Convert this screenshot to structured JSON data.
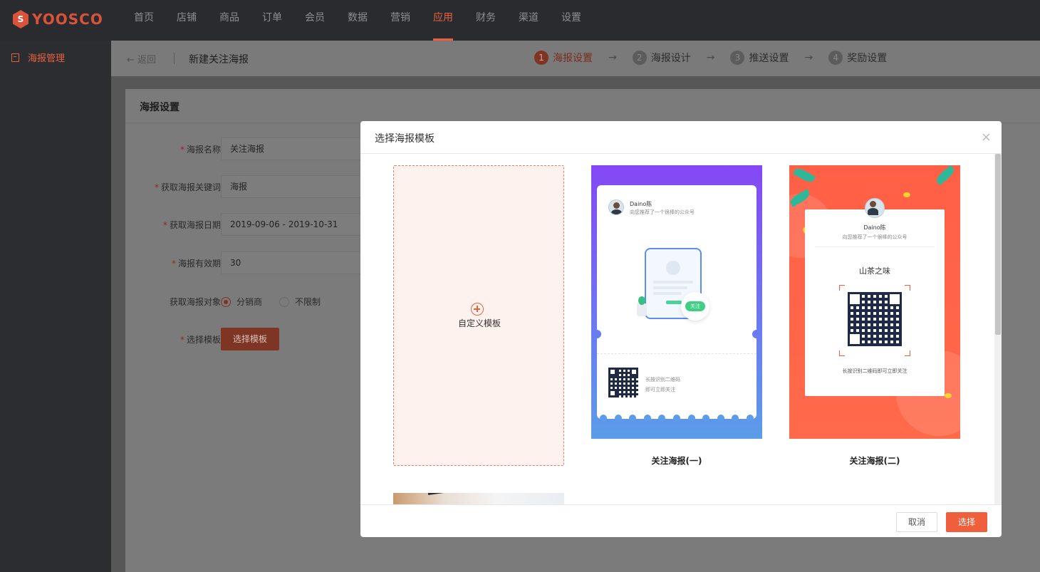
{
  "brand": {
    "logo_letter": "S",
    "name": "YOOSCO",
    "color": "#d9533b"
  },
  "nav": {
    "items": [
      "首页",
      "店铺",
      "商品",
      "订单",
      "会员",
      "数据",
      "营销",
      "应用",
      "财务",
      "渠道",
      "设置"
    ],
    "active": "应用"
  },
  "sidebar": {
    "items": [
      {
        "label": "海报管理",
        "icon": "poster-icon"
      }
    ]
  },
  "header": {
    "back_label": "返回",
    "title": "新建关注海报",
    "steps": [
      {
        "num": "1",
        "label": "海报设置",
        "active": true
      },
      {
        "num": "2",
        "label": "海报设计",
        "active": false
      },
      {
        "num": "3",
        "label": "推送设置",
        "active": false
      },
      {
        "num": "4",
        "label": "奖励设置",
        "active": false
      }
    ]
  },
  "form": {
    "section_title": "海报设置",
    "fields": [
      {
        "label": "海报名称",
        "required": true,
        "value": "关注海报"
      },
      {
        "label": "获取海报关键词",
        "required": true,
        "value": "海报"
      },
      {
        "label": "获取海报日期",
        "required": true,
        "value": "2019-09-06 - 2019-10-31"
      },
      {
        "label": "海报有效期",
        "required": true,
        "value": "30"
      }
    ],
    "target": {
      "label": "获取海报对象",
      "options": [
        "分销商",
        "不限制"
      ],
      "selected": "分销商"
    },
    "template": {
      "label": "选择模板",
      "required": true,
      "button": "选择模板"
    }
  },
  "modal": {
    "title": "选择海报模板",
    "close": "×",
    "custom_label": "自定义模板",
    "templates": [
      {
        "name": "关注海报(一)",
        "user": "Daino陈",
        "recommend": "向您推荐了一个很棒的公众号",
        "follow_badge": "关注",
        "scan_line1": "长按识别二维码",
        "scan_line2": "即可立即关注"
      },
      {
        "name": "关注海报(二)",
        "user": "Daino陈",
        "recommend": "向您推荐了一个很棒的公众号",
        "account": "山茶之味",
        "scan_hint": "长按识别二维码即可立即关注"
      }
    ],
    "cancel_label": "取消",
    "select_label": "选择"
  },
  "colors": {
    "accent": "#ef5f3b",
    "template1_top": "#8547f5",
    "template1_bottom": "#5c9ce8",
    "template2": "#ff5f46"
  }
}
